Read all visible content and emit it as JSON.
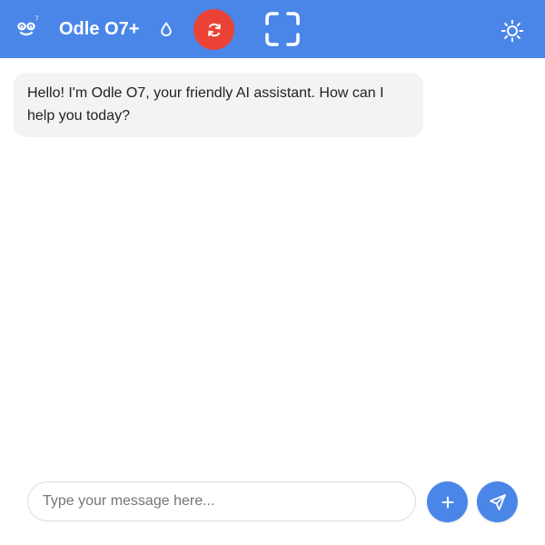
{
  "header": {
    "title": "Odle O7+",
    "logo_badge": "7",
    "logo_icon": "smiley-face-icon",
    "drop_icon": "water-drop-icon",
    "refresh_icon": "refresh-icon",
    "frame_icon": "fullscreen-frame-icon",
    "theme_icon": "sun-icon"
  },
  "chat": {
    "messages": [
      {
        "sender": "assistant",
        "text": "Hello! I'm Odle O7, your friendly AI assistant. How can I help you today?"
      }
    ]
  },
  "composer": {
    "placeholder": "Type your message here...",
    "value": "",
    "add_icon": "plus-icon",
    "send_icon": "send-icon"
  },
  "colors": {
    "header_bg": "#4a86e8",
    "refresh_bg": "#ea4335",
    "bubble_bg": "#f1f3f4",
    "action_bg": "#4a86e8"
  }
}
